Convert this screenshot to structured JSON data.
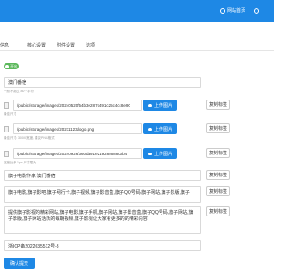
{
  "topbar": {
    "home_label": "网站首页",
    "user_label": ""
  },
  "tabs": [
    "信息",
    "核心设置",
    "附件设置",
    "选项"
  ],
  "status_toggle": "开启",
  "site_title": {
    "value": "澳门番宿",
    "hint": "一般不超过 80个字符"
  },
  "images": [
    {
      "path": "/public/storage/images/20240520/54b3e287c491c25c4cc8e90",
      "hint": "最佳尺寸",
      "upload_label": "上传图片",
      "copy_label": "复制标签"
    },
    {
      "path": "/public/storage/images/20211123/logo.png",
      "hint": "最佳尺寸: 300X 宽度, 建议PNG格式",
      "upload_label": "上传图片",
      "copy_label": "复制标签"
    },
    {
      "path": "/public/storage/images/20240926/360da91e21928568800b4",
      "hint": "宽度比例 1px 尺寸限为",
      "upload_label": "上传图片",
      "copy_label": "复制标签"
    }
  ],
  "keywords": {
    "value": "旗子电影作家·澳门番宿",
    "copy_label": "复制标签"
  },
  "tags": {
    "value": "旗子电影,旗子影吧,旗子网行卡,旗子视频,旗子影音盒,旗子QQ号码,旗子网站,旗子影版,旗子",
    "copy_label": "复制标签"
  },
  "description": {
    "value": "提供旗子影视的精彩网站,旗子电影,旗子手机,旗子网站,旗子影音盒,旗子QQ号码,旗子网站,旗子影版,旗子网站活跃的每期视频,旗子影视让大家看更多的的精彩内容",
    "copy_label": "复制标签"
  },
  "icp": {
    "value": "浙ICP备2022035512号-3"
  },
  "submit_label": "确认提交"
}
